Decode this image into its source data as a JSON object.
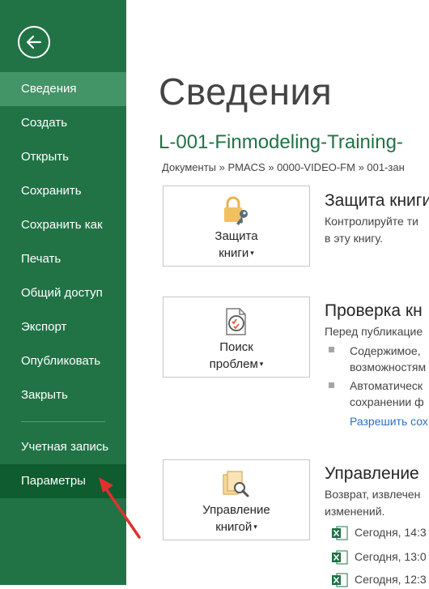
{
  "sidebar": {
    "items": [
      {
        "label": "Сведения"
      },
      {
        "label": "Создать"
      },
      {
        "label": "Открыть"
      },
      {
        "label": "Сохранить"
      },
      {
        "label": "Сохранить как"
      },
      {
        "label": "Печать"
      },
      {
        "label": "Общий доступ"
      },
      {
        "label": "Экспорт"
      },
      {
        "label": "Опубликовать"
      },
      {
        "label": "Закрыть"
      },
      {
        "label": "Учетная запись"
      },
      {
        "label": "Параметры"
      }
    ]
  },
  "main": {
    "title": "Сведения",
    "file_name": "L-001-Finmodeling-Training-",
    "breadcrumb": "Документы » PMACS » 0000-VIDEO-FM » 001-зан",
    "protect": {
      "button_line1": "Защита",
      "button_line2": "книги",
      "title": "Защита книги",
      "desc1": "Контролируйте ти",
      "desc2": "в эту книгу."
    },
    "inspect": {
      "button_line1": "Поиск",
      "button_line2": "проблем",
      "title": "Проверка кн",
      "desc": "Перед публикацие",
      "bullet1_line1": "Содержимое,",
      "bullet1_line2": "возможностям",
      "bullet2_line1": "Автоматическ",
      "bullet2_line2": "сохранении ф",
      "link": "Разрешить сох"
    },
    "manage": {
      "button_line1": "Управление",
      "button_line2": "книгой",
      "title": "Управление",
      "desc1": "Возврат, извлечен",
      "desc2": "изменений.",
      "versions": [
        "Сегодня, 14:3",
        "Сегодня, 13:0",
        "Сегодня, 12:3"
      ]
    }
  },
  "colors": {
    "sidebar_bg": "#217346",
    "active_bg": "#439467",
    "accent_green": "#217346",
    "annotation_arrow": "#e0312f",
    "link": "#2a71c2"
  },
  "icons": [
    "back-arrow-icon",
    "lock-icon",
    "key-icon",
    "inspect-document-icon",
    "manage-versions-icon",
    "excel-file-icon",
    "red-annotation-arrow"
  ]
}
